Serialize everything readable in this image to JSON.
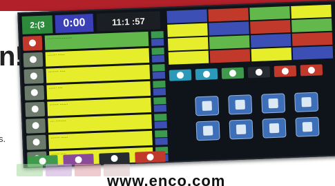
{
  "headline": "n!",
  "subtext": "s.",
  "url": "www.enco.com",
  "header": {
    "mode": "2:(3",
    "timer": "0:00",
    "clock": "11:1 :57"
  },
  "list_rows": [
    {
      "text": "......................",
      "style": "green"
    },
    {
      "text": "........ ......",
      "style": "yellow"
    },
    {
      "text": "......... .....",
      "style": "yellow"
    },
    {
      "text": "....... ....",
      "style": "yellow"
    },
    {
      "text": "........ .......",
      "style": "yellow"
    },
    {
      "text": ".... .........",
      "style": "yellow"
    },
    {
      "text": "........ ......",
      "style": "yellow"
    },
    {
      "text": "....... .....",
      "style": "yellow"
    }
  ],
  "colors": {
    "brand_red": "#b2202a",
    "green": "#4aa35a",
    "yellow": "#e6ee2c",
    "blue": "#3b4fb4",
    "red": "#c0392b"
  },
  "icons": [
    "person-icon",
    "document-icon",
    "folder-icon",
    "monitor-icon",
    "settings-icon",
    "globe-icon",
    "calendar-icon",
    "file-icon"
  ]
}
